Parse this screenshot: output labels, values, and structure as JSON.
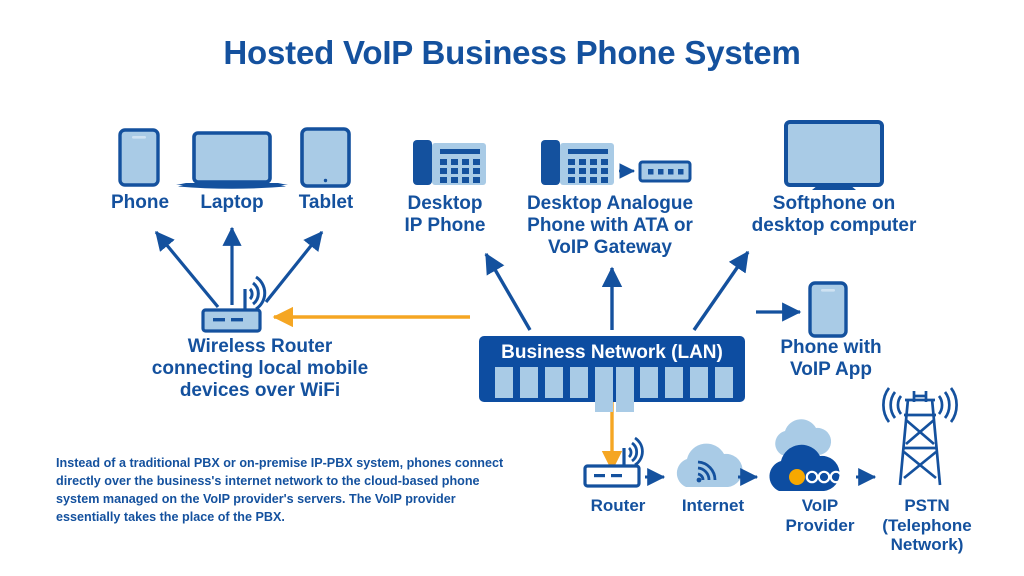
{
  "title": "Hosted VoIP Business Phone System",
  "colors": {
    "brand_blue": "#14519e",
    "lan_blue": "#0d4da1",
    "light_blue": "#a9cbe6",
    "orange": "#f5a623",
    "white": "#ffffff"
  },
  "nodes": {
    "phone": {
      "label": "Phone",
      "icon": "smartphone-icon"
    },
    "laptop": {
      "label": "Laptop",
      "icon": "laptop-icon"
    },
    "tablet": {
      "label": "Tablet",
      "icon": "tablet-icon"
    },
    "desktop_ip_phone": {
      "label": "Desktop\nIP Phone",
      "line1": "Desktop",
      "line2": "IP Phone",
      "icon": "desk-phone-icon"
    },
    "analogue_phone": {
      "line1": "Desktop Analogue",
      "line2": "Phone with ATA or",
      "line3": "VoIP Gateway",
      "icon": "desk-phone-icon",
      "adapter_icon": "ata-box-icon",
      "adapter_ports": 4
    },
    "softphone": {
      "line1": "Softphone on",
      "line2": "desktop computer",
      "icon": "monitor-icon"
    },
    "wireless_router": {
      "line1": "Wireless Router",
      "line2": "connecting local mobile",
      "line3": "devices over WiFi",
      "icon": "wifi-router-icon"
    },
    "phone_with_app": {
      "line1": "Phone with",
      "line2": "VoIP App",
      "icon": "smartphone-icon"
    },
    "business_network": {
      "label": "Business Network (LAN)",
      "ports": 10,
      "tall_ports": [
        5,
        6
      ]
    },
    "branch_router": {
      "label": "Router",
      "icon": "wifi-router-icon"
    },
    "internet": {
      "label": "Internet",
      "icon": "cloud-wifi-icon"
    },
    "voip_provider": {
      "line1": "VoIP",
      "line2": "Provider",
      "icon": "cloud-server-icon",
      "dots": 4
    },
    "pstn": {
      "line1": "PSTN",
      "line2": "(Telephone",
      "line3": "Network)",
      "icon": "cell-tower-icon"
    }
  },
  "paragraph": "Instead of a traditional PBX or on-premise IP-PBX system, phones connect directly over the business's internet network to the cloud-based phone system managed on the VoIP provider's servers. The VoIP provider essentially takes the place of the PBX."
}
